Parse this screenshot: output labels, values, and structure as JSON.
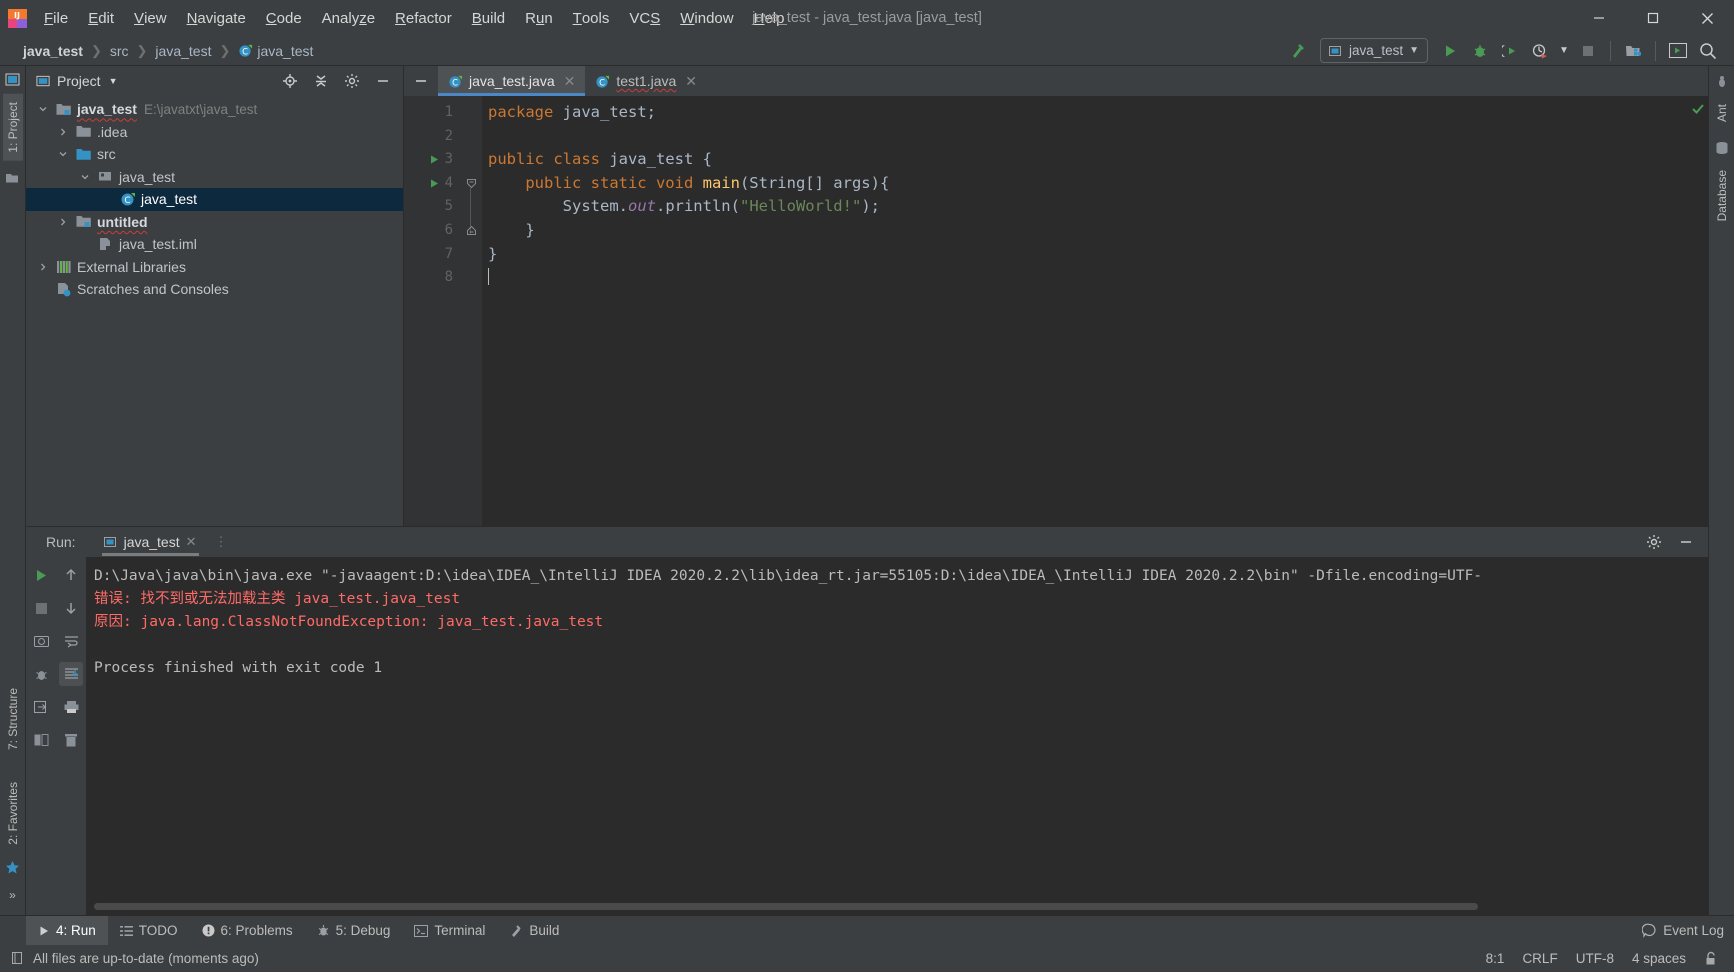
{
  "window": {
    "title": "java_test - java_test.java [java_test]",
    "minimize_icon": "minimize-icon",
    "maximize_icon": "maximize-icon",
    "close_icon": "close-icon"
  },
  "menubar": {
    "items": [
      {
        "label": "File",
        "mnemonic": "F"
      },
      {
        "label": "Edit",
        "mnemonic": "E"
      },
      {
        "label": "View",
        "mnemonic": "V"
      },
      {
        "label": "Navigate",
        "mnemonic": "N"
      },
      {
        "label": "Code",
        "mnemonic": "C"
      },
      {
        "label": "Analyze",
        "mnemonic": "z"
      },
      {
        "label": "Refactor",
        "mnemonic": "R"
      },
      {
        "label": "Build",
        "mnemonic": "B"
      },
      {
        "label": "Run",
        "mnemonic": "u"
      },
      {
        "label": "Tools",
        "mnemonic": "T"
      },
      {
        "label": "VCS",
        "mnemonic": "S"
      },
      {
        "label": "Window",
        "mnemonic": "W"
      },
      {
        "label": "Help",
        "mnemonic": "H"
      }
    ]
  },
  "navbar": {
    "breadcrumbs": [
      {
        "label": "java_test",
        "bold": true,
        "icon": ""
      },
      {
        "label": "src",
        "bold": false,
        "icon": ""
      },
      {
        "label": "java_test",
        "bold": false,
        "icon": ""
      },
      {
        "label": "java_test",
        "bold": false,
        "icon": "class-icon"
      }
    ],
    "run_config": "java_test",
    "icons": [
      "build-hammer-icon",
      "run-icon",
      "debug-icon",
      "run-coverage-icon",
      "profiler-icon",
      "stop-icon",
      "project-structure-icon",
      "terminal-icon",
      "search-icon"
    ]
  },
  "project_panel": {
    "title": "Project",
    "header_icons": [
      "locate-icon",
      "collapse-all-icon",
      "gear-icon",
      "hide-icon"
    ],
    "tree": [
      {
        "label": "java_test",
        "path": "E:\\javatxt\\java_test",
        "icon": "module-folder-icon",
        "indent": 0,
        "arrow": "down",
        "bold": true,
        "wavy": true,
        "selected": false
      },
      {
        "label": ".idea",
        "path": "",
        "icon": "folder-icon",
        "indent": 1,
        "arrow": "right",
        "bold": false,
        "wavy": false,
        "selected": false
      },
      {
        "label": "src",
        "path": "",
        "icon": "source-folder-icon",
        "indent": 1,
        "arrow": "down",
        "bold": false,
        "wavy": false,
        "selected": false
      },
      {
        "label": "java_test",
        "path": "",
        "icon": "package-icon",
        "indent": 2,
        "arrow": "down",
        "bold": false,
        "wavy": false,
        "selected": false
      },
      {
        "label": "java_test",
        "path": "",
        "icon": "class-icon",
        "indent": 3,
        "arrow": "none",
        "bold": false,
        "wavy": false,
        "selected": true
      },
      {
        "label": "untitled",
        "path": "",
        "icon": "module-folder-icon",
        "indent": 1,
        "arrow": "right",
        "bold": true,
        "wavy": true,
        "selected": false
      },
      {
        "label": "java_test.iml",
        "path": "",
        "icon": "iml-file-icon",
        "indent": 2,
        "arrow": "none",
        "bold": false,
        "wavy": false,
        "selected": false
      },
      {
        "label": "External Libraries",
        "path": "",
        "icon": "libraries-icon",
        "indent": 0,
        "arrow": "right",
        "bold": false,
        "wavy": false,
        "selected": false
      },
      {
        "label": "Scratches and Consoles",
        "path": "",
        "icon": "scratches-icon",
        "indent": 0,
        "arrow": "none",
        "bold": false,
        "wavy": false,
        "selected": false
      }
    ]
  },
  "editor": {
    "tabs": [
      {
        "label": "java_test.java",
        "icon": "class-icon",
        "active": true,
        "wavy": false
      },
      {
        "label": "test1.java",
        "icon": "class-icon",
        "active": false,
        "wavy": true
      }
    ],
    "lines": [
      {
        "n": "1",
        "runmark": false,
        "fold": "none"
      },
      {
        "n": "2",
        "runmark": false,
        "fold": "none"
      },
      {
        "n": "3",
        "runmark": true,
        "fold": "none"
      },
      {
        "n": "4",
        "runmark": true,
        "fold": "open"
      },
      {
        "n": "5",
        "runmark": false,
        "fold": "none"
      },
      {
        "n": "6",
        "runmark": false,
        "fold": "close"
      },
      {
        "n": "7",
        "runmark": false,
        "fold": "none"
      },
      {
        "n": "8",
        "runmark": false,
        "fold": "none"
      }
    ],
    "code_text": [
      "package java_test;",
      "",
      "public class java_test {",
      "    public static void main(String[] args){",
      "        System.out.println(\"HelloWorld!\");",
      "    }",
      "}",
      ""
    ],
    "inspection_status": "ok-check-icon"
  },
  "run_panel": {
    "label": "Run:",
    "tab_label": "java_test",
    "tab_icon": "run-config-icon",
    "close_icon": "close-icon",
    "gear_icon": "gear-icon",
    "hide_icon": "hide-icon",
    "side_buttons": [
      "rerun-icon",
      "stop-icon",
      "screenshot-icon",
      "print-icon",
      "trash-icon",
      "up-icon",
      "down-icon",
      "soft-wrap-icon",
      "scroll-to-end-icon"
    ],
    "console": [
      {
        "text": "D:\\Java\\java\\bin\\java.exe \"-javaagent:D:\\idea\\IDEA_\\IntelliJ IDEA 2020.2.2\\lib\\idea_rt.jar=55105:D:\\idea\\IDEA_\\IntelliJ IDEA 2020.2.2\\bin\" -Dfile.encoding=UTF-",
        "error": false
      },
      {
        "text": "错误: 找不到或无法加载主类 java_test.java_test",
        "error": true
      },
      {
        "text": "原因: java.lang.ClassNotFoundException: java_test.java_test",
        "error": true
      },
      {
        "text": "",
        "error": false
      },
      {
        "text": "Process finished with exit code 1",
        "error": false
      }
    ]
  },
  "left_rail": {
    "top_tabs": [
      {
        "label": "1: Project",
        "icon": "project-icon",
        "active": true
      }
    ],
    "bottom_icons": [
      "structure-icon",
      "favorites-icon"
    ],
    "structure_label": "7: Structure",
    "favorites_label": "2: Favorites",
    "more_icon": "more-icon"
  },
  "right_rail": {
    "tabs": [
      {
        "label": "Ant",
        "icon": "ant-icon"
      },
      {
        "label": "Database",
        "icon": "database-icon"
      }
    ]
  },
  "bottom_toolbar": {
    "tabs": [
      {
        "label": "4: Run",
        "mnemonic": "4",
        "icon": "run-icon",
        "active": true
      },
      {
        "label": "TODO",
        "mnemonic": "",
        "icon": "todo-icon",
        "active": false
      },
      {
        "label": "6: Problems",
        "mnemonic": "6",
        "icon": "problems-icon",
        "active": false
      },
      {
        "label": "5: Debug",
        "mnemonic": "5",
        "icon": "debug-icon",
        "active": false
      },
      {
        "label": "Terminal",
        "mnemonic": "",
        "icon": "terminal-icon",
        "active": false
      },
      {
        "label": "Build",
        "mnemonic": "",
        "icon": "build-icon",
        "active": false
      }
    ],
    "event_log": "Event Log",
    "event_log_icon": "event-log-icon"
  },
  "statusbar": {
    "message": "All files are up-to-date (moments ago)",
    "message_icon": "files-icon",
    "caret_position": "8:1",
    "line_separator": "CRLF",
    "encoding": "UTF-8",
    "indent": "4 spaces",
    "lock_icon": "unlock-icon"
  },
  "colors": {
    "bg_chrome": "#3c3f41",
    "bg_editor": "#2b2b2b",
    "accent_blue": "#4a88c7",
    "selection": "#0d293e",
    "keyword": "#cc7832",
    "string": "#6a8759",
    "method": "#ffc66d",
    "field": "#9876aa",
    "error": "#ff6b68",
    "green": "#499c54"
  }
}
